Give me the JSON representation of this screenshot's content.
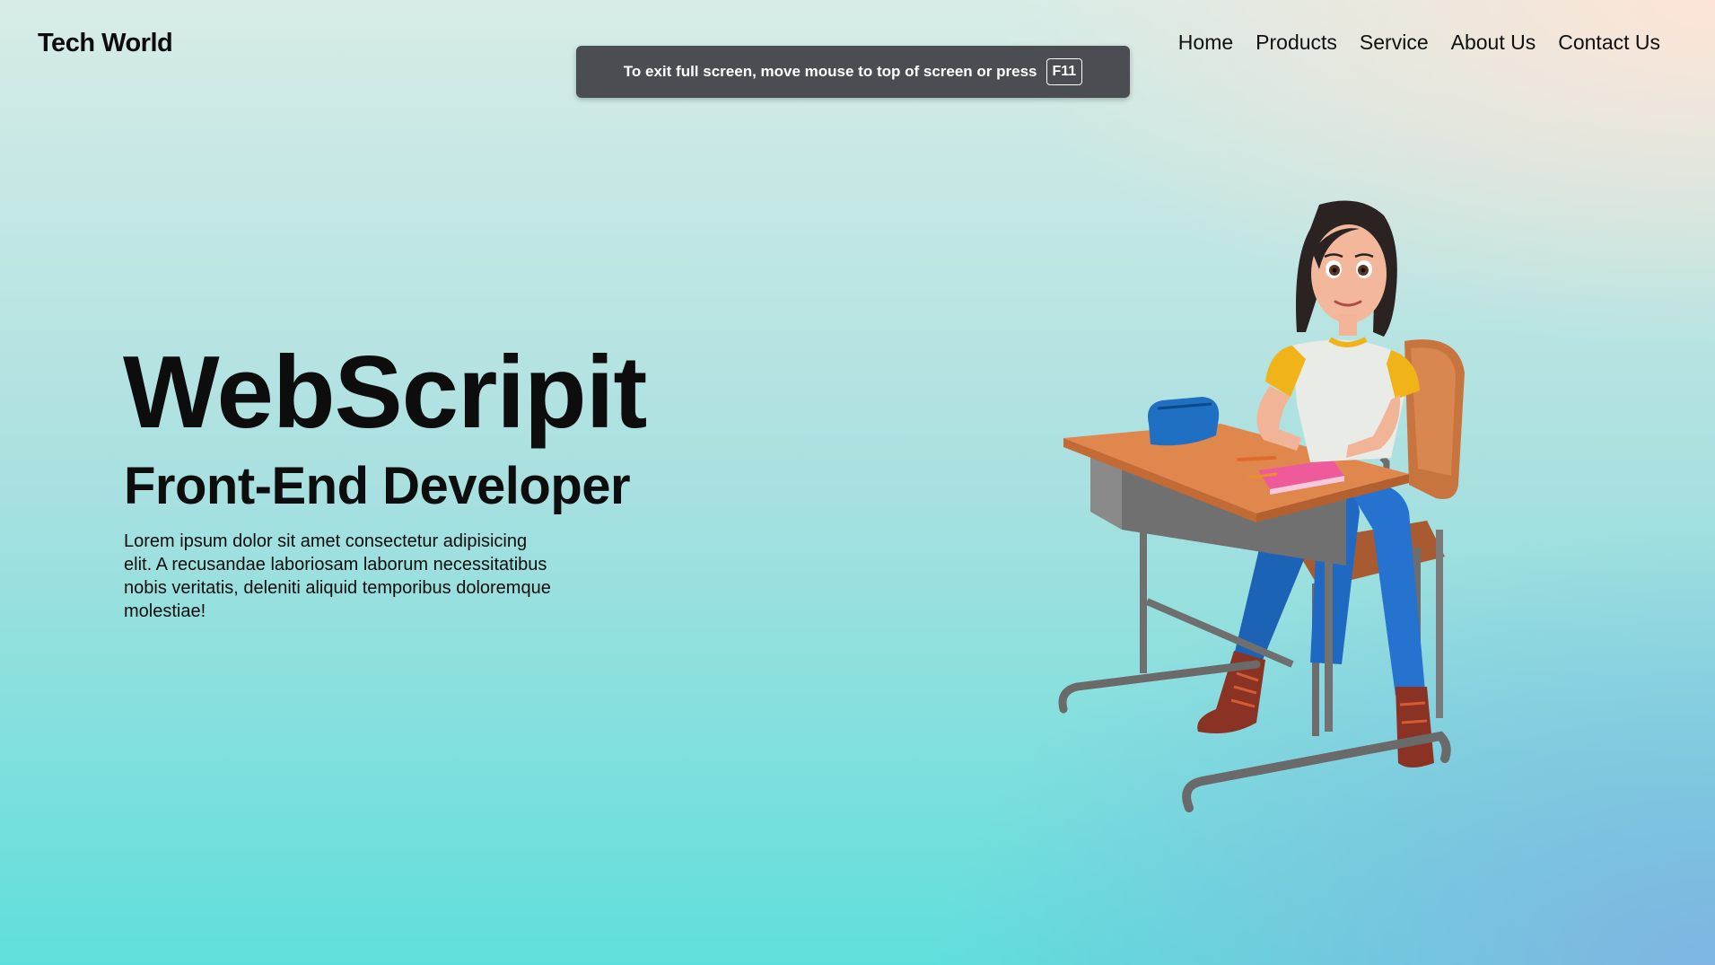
{
  "header": {
    "logo": "Tech World",
    "nav": [
      "Home",
      "Products",
      "Service",
      "About Us",
      "Contact Us"
    ]
  },
  "toast": {
    "message": "To exit full screen, move mouse to top of screen or press",
    "key": "F11"
  },
  "hero": {
    "title": "WebScripit",
    "subtitle": "Front-End Developer",
    "text": "Lorem ipsum dolor sit amet consectetur adipisicing elit. A recusandae laboriosam laborum necessitatibus nobis veritatis, deleniti aliquid temporibus doloremque molestiae!"
  },
  "illustration": {
    "icon": "student-at-desk-illustration"
  },
  "colors": {
    "background_top": "#d7ece7",
    "background_bottom": "#5fdfdb",
    "accent_peach": "#ffe4d6",
    "accent_blue": "#82b2e2",
    "toast_bg": "#4a4e52",
    "text": "#0d0d0d"
  }
}
